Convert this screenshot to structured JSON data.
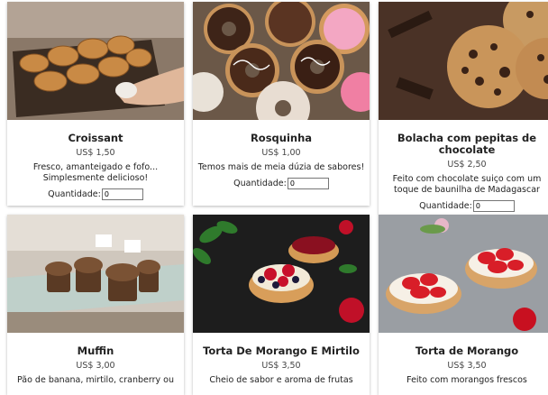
{
  "currency": "US$",
  "quantity_label": "Quantidade:",
  "products": [
    {
      "name": "Croissant",
      "price": "US$ 1,50",
      "description": "Fresco, amanteigado e fofo... Simplesmente delicioso!",
      "quantity": "0"
    },
    {
      "name": "Rosquinha",
      "price": "US$ 1,00",
      "description": "Temos mais de meia dúzia de sabores!",
      "quantity": "0"
    },
    {
      "name": "Bolacha com pepitas de chocolate",
      "price": "US$ 2,50",
      "description": "Feito com chocolate suiço com um toque de baunilha de Madagascar",
      "quantity": "0"
    },
    {
      "name": "Muffin",
      "price": "US$ 3,00",
      "description": "Pão de banana, mirtilo, cranberry ou"
    },
    {
      "name": "Torta De Morango E Mirtilo",
      "price": "US$ 3,50",
      "description": "Cheio de sabor e aroma de frutas"
    },
    {
      "name": "Torta de Morango",
      "price": "US$ 3,50",
      "description": "Feito com morangos frescos"
    }
  ]
}
